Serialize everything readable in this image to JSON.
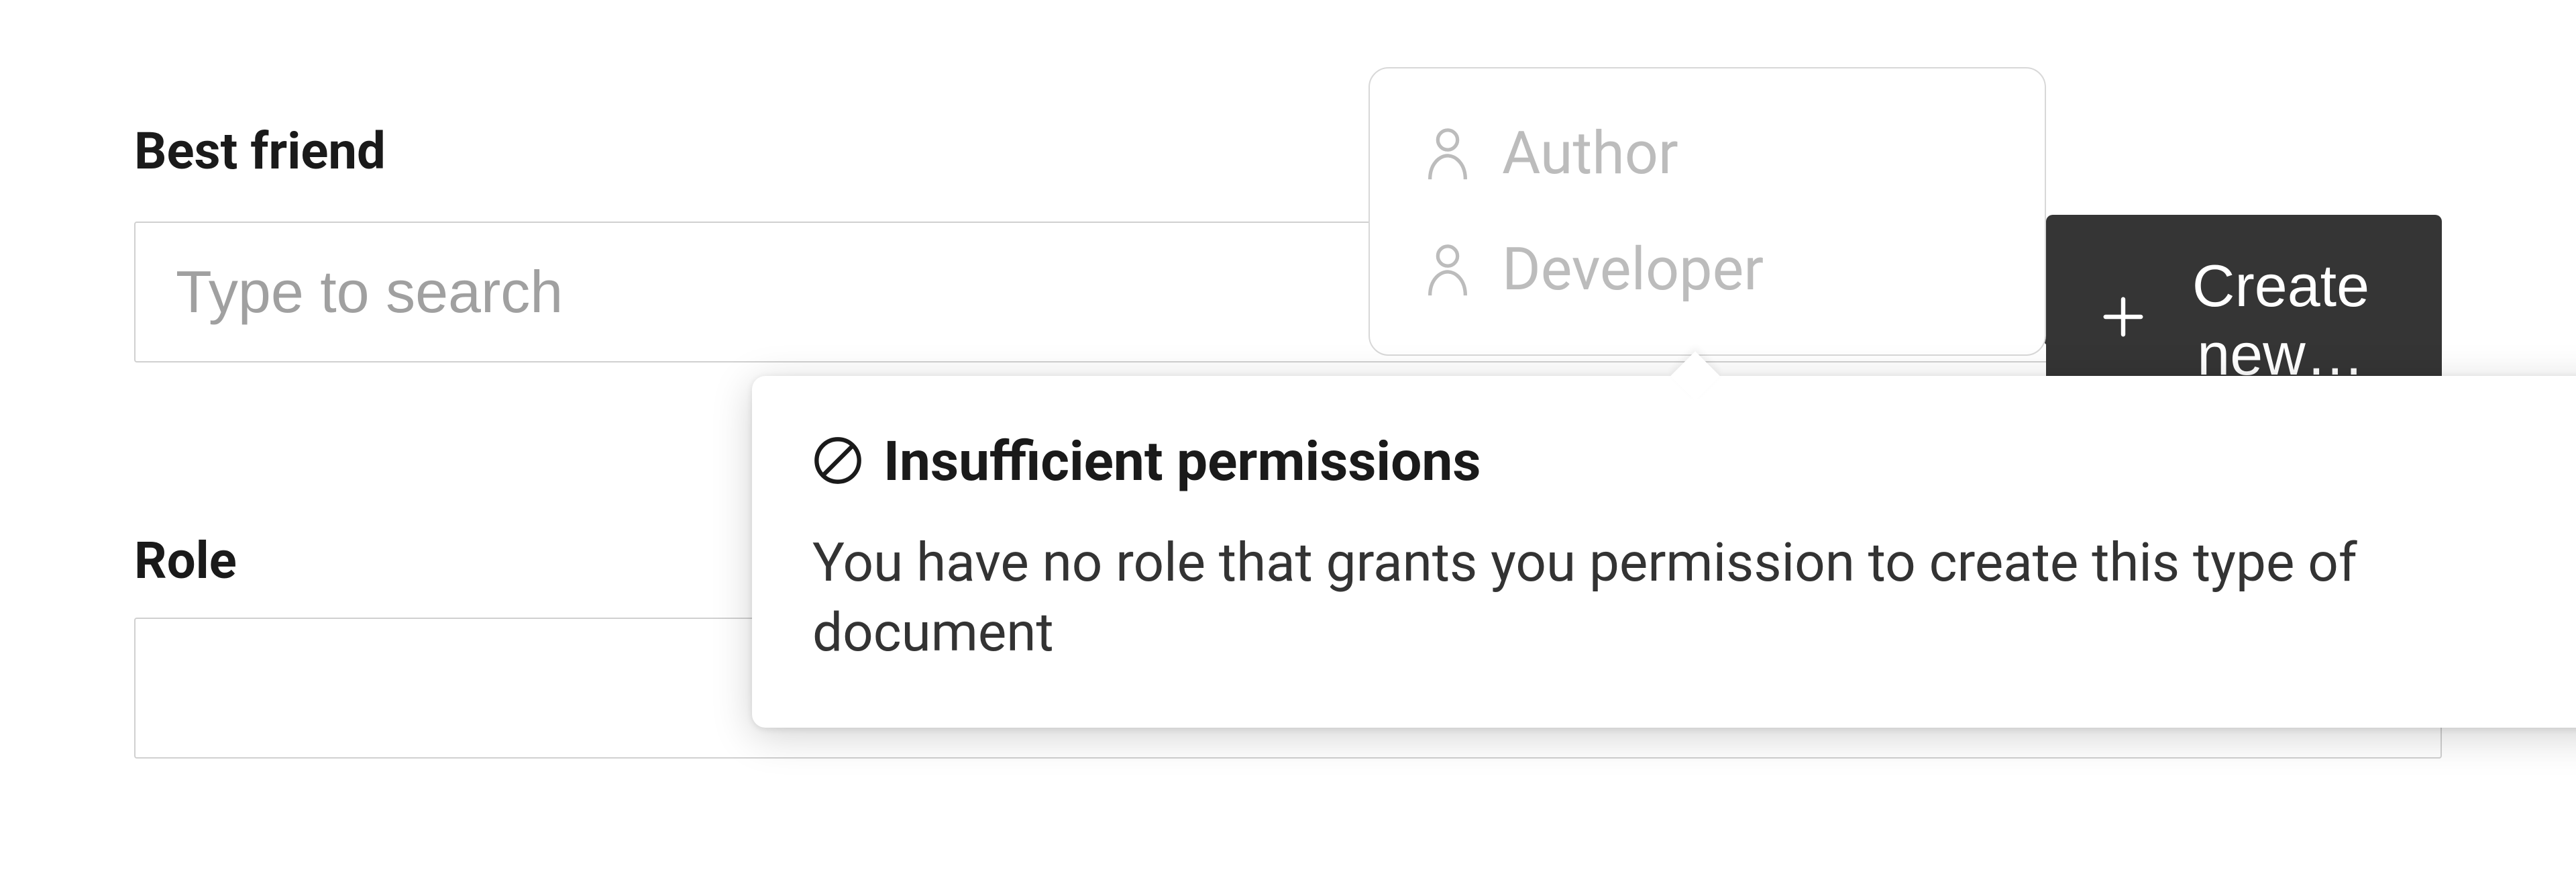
{
  "bestFriend": {
    "label": "Best friend",
    "placeholder": "Type to search",
    "dropdown": {
      "items": [
        {
          "label": "Author"
        },
        {
          "label": "Developer"
        }
      ]
    },
    "createButton": {
      "label": "Create new…"
    }
  },
  "tooltip": {
    "title": "Insufficient permissions",
    "body": "You have no role that grants you permission to create this type of document"
  },
  "role": {
    "label": "Role"
  }
}
